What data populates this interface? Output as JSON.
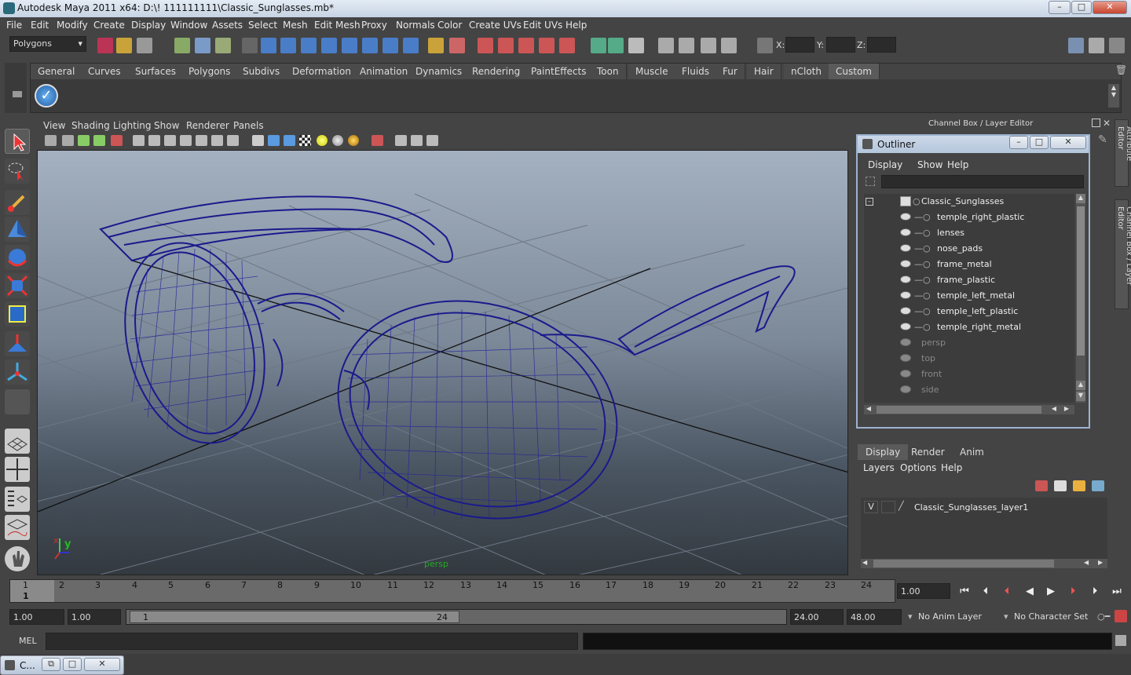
{
  "window": {
    "title": "Autodesk Maya 2011 x64: D:\\! 111111111\\Classic_Sunglasses.mb*",
    "minimize": "–",
    "maximize": "□",
    "close": "✕"
  },
  "menubar": [
    "File",
    "Edit",
    "Modify",
    "Create",
    "Display",
    "Window",
    "Assets",
    "Select",
    "Mesh",
    "Edit Mesh",
    "Proxy",
    "Normals",
    "Color",
    "Create UVs",
    "Edit UVs",
    "Help"
  ],
  "statusline": {
    "mode": "Polygons",
    "x_label": "X:",
    "y_label": "Y:",
    "z_label": "Z:"
  },
  "shelf": {
    "tabs": [
      "General",
      "Curves",
      "Surfaces",
      "Polygons",
      "Subdivs",
      "Deformation",
      "Animation",
      "Dynamics",
      "Rendering",
      "PaintEffects",
      "Toon",
      "Muscle",
      "Fluids",
      "Fur",
      "Hair",
      "nCloth",
      "Custom"
    ],
    "active_tab": "Custom"
  },
  "viewport": {
    "menu": [
      "View",
      "Shading",
      "Lighting",
      "Show",
      "Renderer",
      "Panels"
    ],
    "camera_label": "persp",
    "axis_x": "x",
    "axis_y": "y"
  },
  "channel_box": {
    "title": "Channel Box / Layer Editor"
  },
  "side_tabs": {
    "attribute_editor": "Attribute Editor",
    "channel_box": "Channel Box / Layer Editor"
  },
  "outliner": {
    "title": "Outliner",
    "menu": [
      "Display",
      "Show",
      "Help"
    ],
    "root": "Classic_Sunglasses",
    "children": [
      "temple_right_plastic",
      "lenses",
      "nose_pads",
      "frame_metal",
      "frame_plastic",
      "temple_left_metal",
      "temple_left_plastic",
      "temple_right_metal"
    ],
    "cameras": [
      "persp",
      "top",
      "front",
      "side"
    ]
  },
  "layer_editor": {
    "tabs": [
      "Display",
      "Render",
      "Anim"
    ],
    "active_tab": "Display",
    "menu": [
      "Layers",
      "Options",
      "Help"
    ],
    "layers": [
      {
        "visible": "V",
        "name": "Classic_Sunglasses_layer1"
      }
    ]
  },
  "time_slider": {
    "ticks": [
      "1",
      "2",
      "3",
      "4",
      "5",
      "6",
      "7",
      "8",
      "9",
      "10",
      "11",
      "12",
      "13",
      "14",
      "15",
      "16",
      "17",
      "18",
      "19",
      "20",
      "21",
      "22",
      "23",
      "24"
    ],
    "current_frame": "1.00",
    "current_marker": "1"
  },
  "range_slider": {
    "start": "1.00",
    "range_start": "1.00",
    "inner_start": "1",
    "inner_end": "24",
    "end": "24.00",
    "range_end": "48.00",
    "anim_layer": "No Anim Layer",
    "character_set": "No Character Set"
  },
  "command_line": {
    "label": "MEL"
  },
  "taskbar": {
    "item": "C..."
  }
}
